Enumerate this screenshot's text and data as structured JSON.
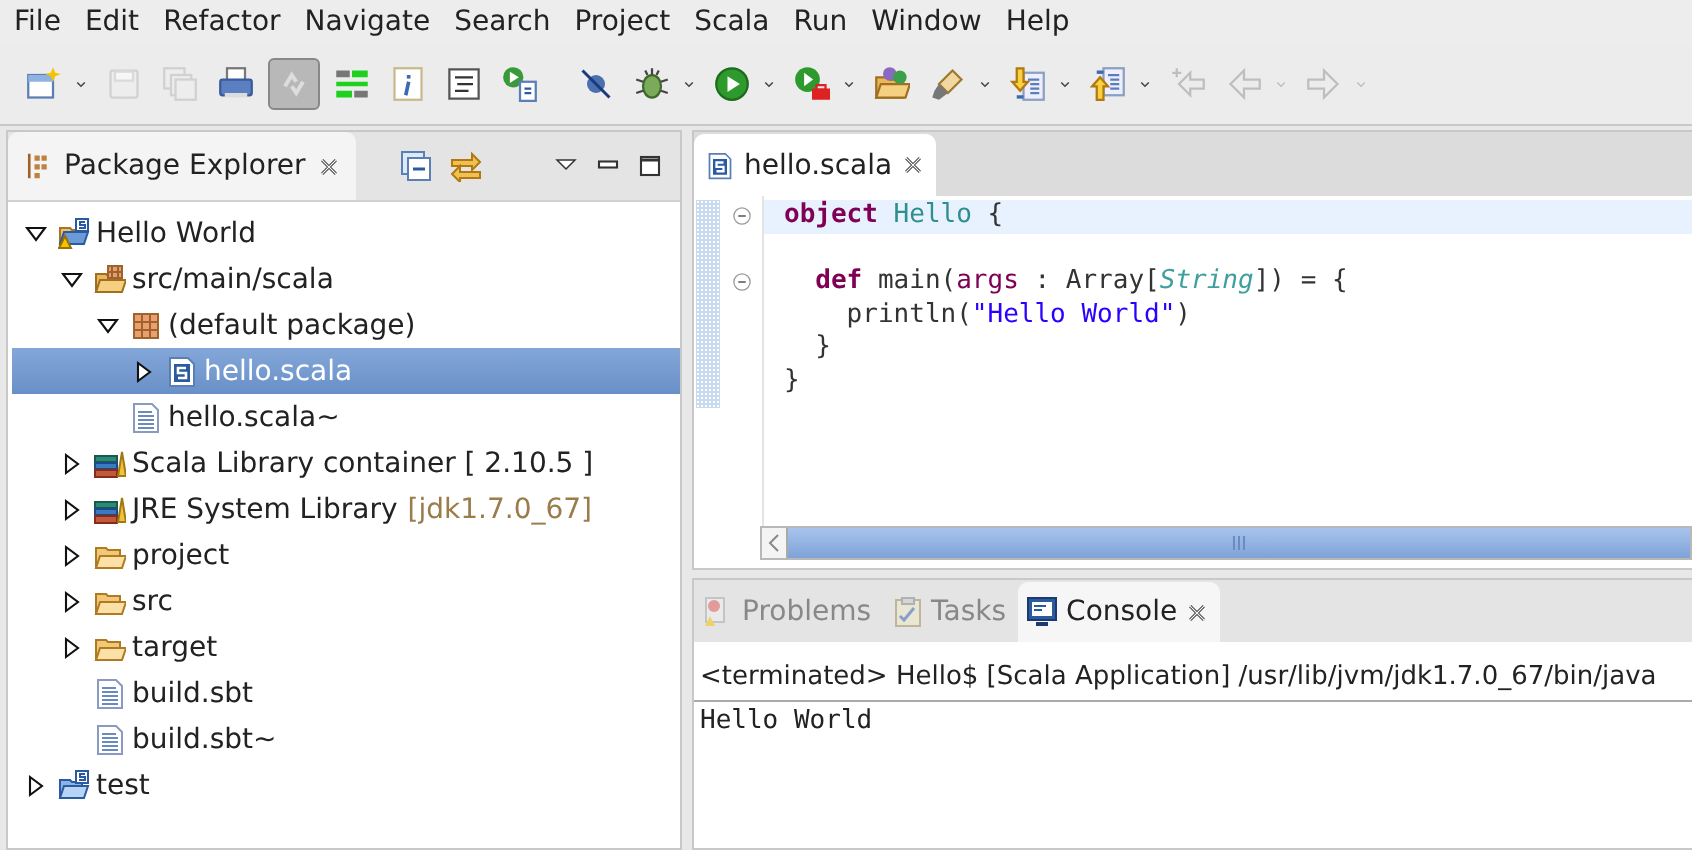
{
  "menu": [
    "File",
    "Edit",
    "Refactor",
    "Navigate",
    "Search",
    "Project",
    "Scala",
    "Run",
    "Window",
    "Help"
  ],
  "toolbar": [
    {
      "kind": "button",
      "disabled": false,
      "pressed": false
    },
    {
      "kind": "caret",
      "disabled": false
    },
    {
      "kind": "button",
      "disabled": true,
      "pressed": false
    },
    {
      "kind": "button",
      "disabled": true,
      "pressed": false
    },
    {
      "kind": "button",
      "disabled": false,
      "pressed": false
    },
    {
      "kind": "button",
      "disabled": false,
      "pressed": true
    },
    {
      "kind": "button",
      "disabled": false,
      "pressed": false
    },
    {
      "kind": "button",
      "disabled": false,
      "pressed": false
    },
    {
      "kind": "button",
      "disabled": false,
      "pressed": false
    },
    {
      "kind": "button",
      "disabled": false,
      "pressed": false
    },
    {
      "kind": "gap"
    },
    {
      "kind": "button",
      "disabled": false,
      "pressed": false
    },
    {
      "kind": "button",
      "disabled": false,
      "pressed": false
    },
    {
      "kind": "caret",
      "disabled": false
    },
    {
      "kind": "button",
      "disabled": false,
      "pressed": false
    },
    {
      "kind": "caret",
      "disabled": false
    },
    {
      "kind": "button",
      "disabled": false,
      "pressed": false
    },
    {
      "kind": "caret",
      "disabled": false
    },
    {
      "kind": "button",
      "disabled": false,
      "pressed": false
    },
    {
      "kind": "button",
      "disabled": false,
      "pressed": false
    },
    {
      "kind": "caret",
      "disabled": false
    },
    {
      "kind": "button",
      "disabled": false,
      "pressed": false
    },
    {
      "kind": "caret",
      "disabled": false
    },
    {
      "kind": "button",
      "disabled": false,
      "pressed": false
    },
    {
      "kind": "caret",
      "disabled": false
    },
    {
      "kind": "button",
      "disabled": true,
      "pressed": false
    },
    {
      "kind": "button",
      "disabled": true,
      "pressed": false
    },
    {
      "kind": "caret",
      "disabled": true
    },
    {
      "kind": "button",
      "disabled": true,
      "pressed": false
    },
    {
      "kind": "caret",
      "disabled": true
    }
  ],
  "package_explorer": {
    "title": "Package Explorer",
    "closable": true,
    "tree": [
      {
        "label": "Hello World",
        "kind": "project-warning",
        "expanded": true,
        "selected": false,
        "children": [
          {
            "label": "src/main/scala",
            "kind": "source-folder",
            "expanded": true,
            "selected": false,
            "children": [
              {
                "label": "(default package)",
                "kind": "package",
                "expanded": true,
                "selected": false,
                "children": [
                  {
                    "label": "hello.scala",
                    "kind": "scala-file",
                    "expanded": false,
                    "selected": true
                  }
                ]
              },
              {
                "label": "hello.scala~",
                "kind": "text-file",
                "selected": false
              }
            ]
          },
          {
            "label": "Scala Library container [ 2.10.5 ]",
            "kind": "library",
            "expanded": false,
            "selected": false
          },
          {
            "label": "JRE System Library",
            "decoration": "[jdk1.7.0_67]",
            "kind": "library",
            "expanded": false,
            "selected": false
          },
          {
            "label": "project",
            "kind": "folder",
            "expanded": false,
            "selected": false
          },
          {
            "label": "src",
            "kind": "folder",
            "expanded": false,
            "selected": false
          },
          {
            "label": "target",
            "kind": "folder",
            "expanded": false,
            "selected": false
          },
          {
            "label": "build.sbt",
            "kind": "text-file",
            "selected": false
          },
          {
            "label": "build.sbt~",
            "kind": "text-file",
            "selected": false
          }
        ]
      },
      {
        "label": "test",
        "kind": "project",
        "expanded": false,
        "selected": false
      }
    ]
  },
  "editor": {
    "tab": {
      "label": "hello.scala",
      "closable": true
    },
    "lines": [
      {
        "fold": true,
        "current": true,
        "tokens": [
          {
            "kind": "keyword",
            "text": "object "
          },
          {
            "kind": "type",
            "text": "Hello"
          },
          {
            "kind": "plain",
            "text": " {"
          }
        ]
      },
      {
        "fold": false,
        "current": false
      },
      {
        "fold": true,
        "current": false,
        "tokens": [
          {
            "kind": "keyword",
            "text": "  def"
          },
          {
            "kind": "plain",
            "text": " main("
          },
          {
            "kind": "param",
            "text": "args"
          },
          {
            "kind": "plain",
            "text": " : Array["
          },
          {
            "kind": "type-param",
            "text": "String"
          },
          {
            "kind": "plain",
            "text": "]) = {"
          }
        ]
      },
      {
        "fold": false,
        "current": false,
        "tokens": [
          {
            "kind": "plain",
            "text": "    println("
          },
          {
            "kind": "string",
            "text": "\"Hello World\""
          },
          {
            "kind": "plain",
            "text": ")"
          }
        ]
      },
      {
        "fold": false,
        "current": false,
        "tokens": [
          {
            "kind": "plain",
            "text": "  }"
          }
        ]
      },
      {
        "fold": false,
        "current": false,
        "tokens": [
          {
            "kind": "plain",
            "text": "}"
          }
        ]
      }
    ]
  },
  "bottom_panel": {
    "tabs": [
      {
        "label": "Problems",
        "selected": false
      },
      {
        "label": "Tasks",
        "selected": false
      },
      {
        "label": "Console",
        "selected": true
      }
    ],
    "console_header": "<terminated> Hello$ [Scala Application] /usr/lib/jvm/jdk1.7.0_67/bin/java",
    "output": "Hello World"
  }
}
